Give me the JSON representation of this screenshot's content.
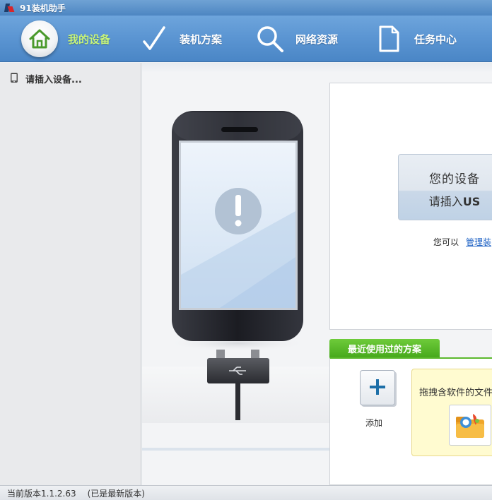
{
  "window": {
    "title": "91装机助手"
  },
  "nav": {
    "items": [
      {
        "label": "我的设备",
        "icon": "home-icon",
        "active": true
      },
      {
        "label": "装机方案",
        "icon": "checkmark-icon",
        "active": false
      },
      {
        "label": "网络资源",
        "icon": "search-icon",
        "active": false
      },
      {
        "label": "任务中心",
        "icon": "document-icon",
        "active": false
      }
    ]
  },
  "sidebar": {
    "items": [
      {
        "label": "请插入设备...",
        "icon": "phone-icon"
      }
    ]
  },
  "main": {
    "device_card": {
      "line1": "您的设备",
      "line2_prefix": "请插入",
      "line2_bold": "US",
      "hint_text": "您可以",
      "hint_link": "管理装"
    },
    "recent": {
      "tab_label": "最近使用过的方案",
      "add_label": "添加",
      "drop_hint": "拖拽含软件的文件"
    }
  },
  "status": {
    "version": "当前版本1.1.2.63",
    "latest": "(已是最新版本)"
  },
  "colors": {
    "nav_bg": "#5c96d3",
    "nav_active_text": "#c8f57a",
    "recent_tab_green": "#47a91c",
    "link_blue": "#1a5fc4"
  }
}
